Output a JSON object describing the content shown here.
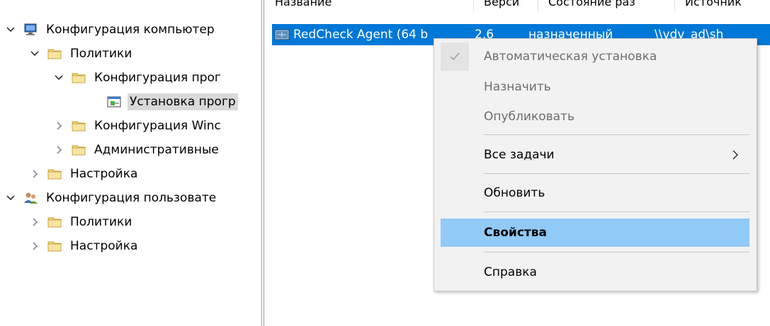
{
  "tree": {
    "items": [
      {
        "label": "Конфигурация компьютер",
        "icon": "computer-icon",
        "expander": "expanded"
      },
      {
        "label": "Политики",
        "icon": "folder-icon",
        "expander": "expanded"
      },
      {
        "label": "Конфигурация прог",
        "icon": "folder-icon",
        "expander": "expanded"
      },
      {
        "label": "Установка прогр",
        "icon": "software-install-icon",
        "expander": "none",
        "selected": true
      },
      {
        "label": "Конфигурация Winc",
        "icon": "folder-icon",
        "expander": "collapsed"
      },
      {
        "label": "Административные",
        "icon": "folder-icon",
        "expander": "collapsed"
      },
      {
        "label": "Настройка",
        "icon": "folder-icon",
        "expander": "collapsed"
      },
      {
        "label": "Конфигурация пользовате",
        "icon": "users-icon",
        "expander": "expanded"
      },
      {
        "label": "Политики",
        "icon": "folder-icon",
        "expander": "collapsed"
      },
      {
        "label": "Настройка",
        "icon": "folder-icon",
        "expander": "collapsed"
      }
    ]
  },
  "list": {
    "columns": [
      "Название",
      "Верси",
      "Состояние раз",
      "Источник"
    ],
    "selected_row": {
      "name": "RedCheck Agent (64 b",
      "version": "2.6",
      "state": "назначенный",
      "source": "\\\\vdv_ad\\sh"
    }
  },
  "context_menu": {
    "items": [
      {
        "label": "Автоматическая установка",
        "disabled": true,
        "checked": true
      },
      {
        "label": "Назначить",
        "disabled": true
      },
      {
        "label": "Опубликовать",
        "disabled": true
      },
      {
        "label": "Все задачи",
        "submenu": true
      },
      {
        "label": "Обновить"
      },
      {
        "label": "Свойства",
        "bold": true,
        "hovered": true
      },
      {
        "label": "Справка"
      }
    ]
  },
  "colors": {
    "selection": "#0078d7",
    "menu_hover": "#91c9f7",
    "menu_bg": "#f2f2f2",
    "tree_selected": "#d9d9d9"
  }
}
